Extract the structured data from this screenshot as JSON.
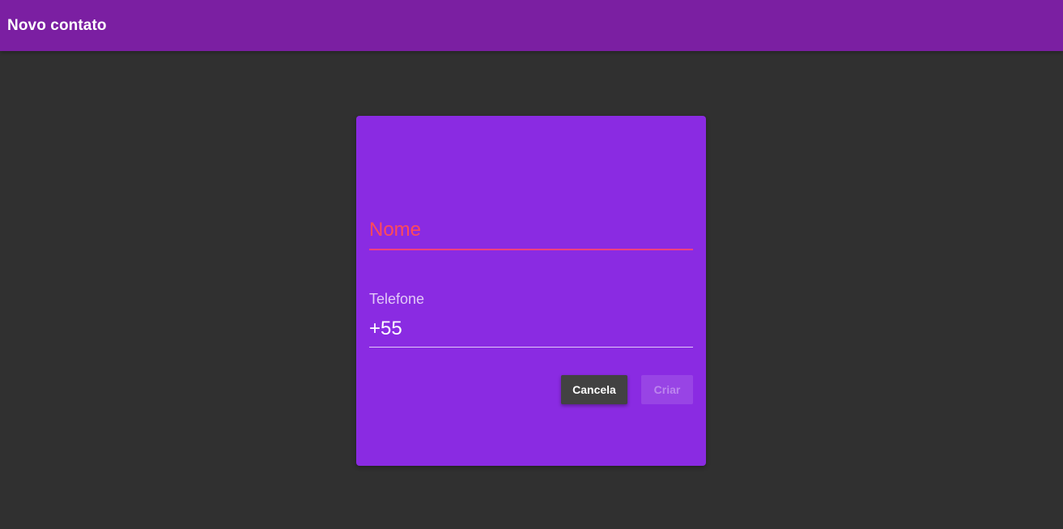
{
  "app_bar": {
    "title": "Novo contato",
    "color": "#7b1fa2"
  },
  "background_color": "#303030",
  "form": {
    "card_color": "#8a2be2",
    "nome": {
      "placeholder": "Nome",
      "value": "",
      "state": "invalid",
      "accent_color": "#ff4081"
    },
    "telefone": {
      "label": "Telefone",
      "value": "+55"
    },
    "buttons": {
      "cancel_label": "Cancela",
      "create_label": "Criar",
      "create_disabled": true
    }
  }
}
